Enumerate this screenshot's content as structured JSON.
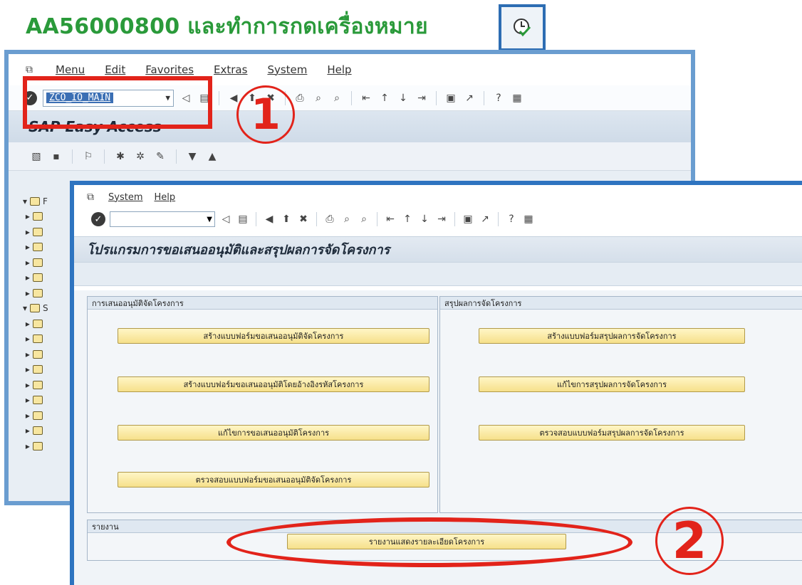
{
  "caption": "AA56000800 และทำการกดเครื่องหมาย",
  "annotations": {
    "step1": "1",
    "step2": "2"
  },
  "back_window": {
    "menu": [
      "Menu",
      "Edit",
      "Favorites",
      "Extras",
      "System",
      "Help"
    ],
    "command_value": "ZCO_IO_MAIN",
    "title": "SAP Easy Access",
    "tree_folders": [
      "F",
      "S"
    ]
  },
  "front_window": {
    "menu": [
      "System",
      "Help"
    ],
    "title": "โปรแกรมการขอเสนออนุมัติและสรุปผลการจัดโครงการ",
    "group_left": {
      "title": "การเสนออนุมัติจัดโครงการ",
      "buttons": [
        "สร้างแบบฟอร์มขอเสนออนุมัติจัดโครงการ",
        "สร้างแบบฟอร์มขอเสนออนุมัติโดยอ้างอิงรหัสโครงการ",
        "แก้ไขการขอเสนออนุมัติโครงการ",
        "ตรวจสอบแบบฟอร์มขอเสนออนุมัติจัดโครงการ"
      ]
    },
    "group_right": {
      "title": "สรุปผลการจัดโครงการ",
      "buttons": [
        "สร้างแบบฟอร์มสรุปผลการจัดโครงการ",
        "แก้ไขการสรุปผลการจัดโครงการ",
        "ตรวจสอบแบบฟอร์มสรุปผลการจัดโครงการ"
      ]
    },
    "group_report": {
      "title": "รายงาน",
      "button": "รายงานแสดงรายละเอียดโครงการ"
    }
  }
}
